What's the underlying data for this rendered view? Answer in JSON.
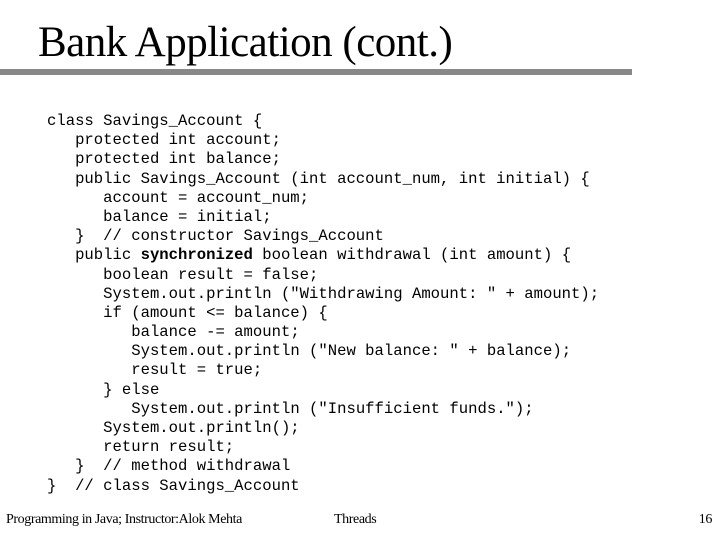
{
  "slide": {
    "title": "Bank Application (cont.)",
    "rule_color": "#888888"
  },
  "code": {
    "lines": [
      {
        "indent": "",
        "pre": "class Savings_Account {",
        "bold": "",
        "post": ""
      },
      {
        "indent": "   ",
        "pre": "protected int account;",
        "bold": "",
        "post": ""
      },
      {
        "indent": "   ",
        "pre": "protected int balance;",
        "bold": "",
        "post": ""
      },
      {
        "indent": "   ",
        "pre": "public Savings_Account (int account_num, int initial) {",
        "bold": "",
        "post": ""
      },
      {
        "indent": "      ",
        "pre": "account = account_num;",
        "bold": "",
        "post": ""
      },
      {
        "indent": "      ",
        "pre": "balance = initial;",
        "bold": "",
        "post": ""
      },
      {
        "indent": "   ",
        "pre": "}  // constructor Savings_Account",
        "bold": "",
        "post": ""
      },
      {
        "indent": "   ",
        "pre": "public ",
        "bold": "synchronized",
        "post": " boolean withdrawal (int amount) {"
      },
      {
        "indent": "      ",
        "pre": "boolean result = false;",
        "bold": "",
        "post": ""
      },
      {
        "indent": "      ",
        "pre": "System.out.println (\"Withdrawing Amount: \" + amount);",
        "bold": "",
        "post": ""
      },
      {
        "indent": "      ",
        "pre": "if (amount <= balance) {",
        "bold": "",
        "post": ""
      },
      {
        "indent": "         ",
        "pre": "balance -= amount;",
        "bold": "",
        "post": ""
      },
      {
        "indent": "         ",
        "pre": "System.out.println (\"New balance: \" + balance);",
        "bold": "",
        "post": ""
      },
      {
        "indent": "         ",
        "pre": "result = true;",
        "bold": "",
        "post": ""
      },
      {
        "indent": "      ",
        "pre": "} else",
        "bold": "",
        "post": ""
      },
      {
        "indent": "         ",
        "pre": "System.out.println (\"Insufficient funds.\");",
        "bold": "",
        "post": ""
      },
      {
        "indent": "      ",
        "pre": "System.out.println();",
        "bold": "",
        "post": ""
      },
      {
        "indent": "      ",
        "pre": "return result;",
        "bold": "",
        "post": ""
      },
      {
        "indent": "   ",
        "pre": "}  // method withdrawal",
        "bold": "",
        "post": ""
      },
      {
        "indent": "",
        "pre": "}  // class Savings_Account",
        "bold": "",
        "post": ""
      }
    ]
  },
  "footer": {
    "course": "Programming in Java; Instructor:Alok Mehta",
    "topic": "Threads",
    "page_number": "16"
  }
}
